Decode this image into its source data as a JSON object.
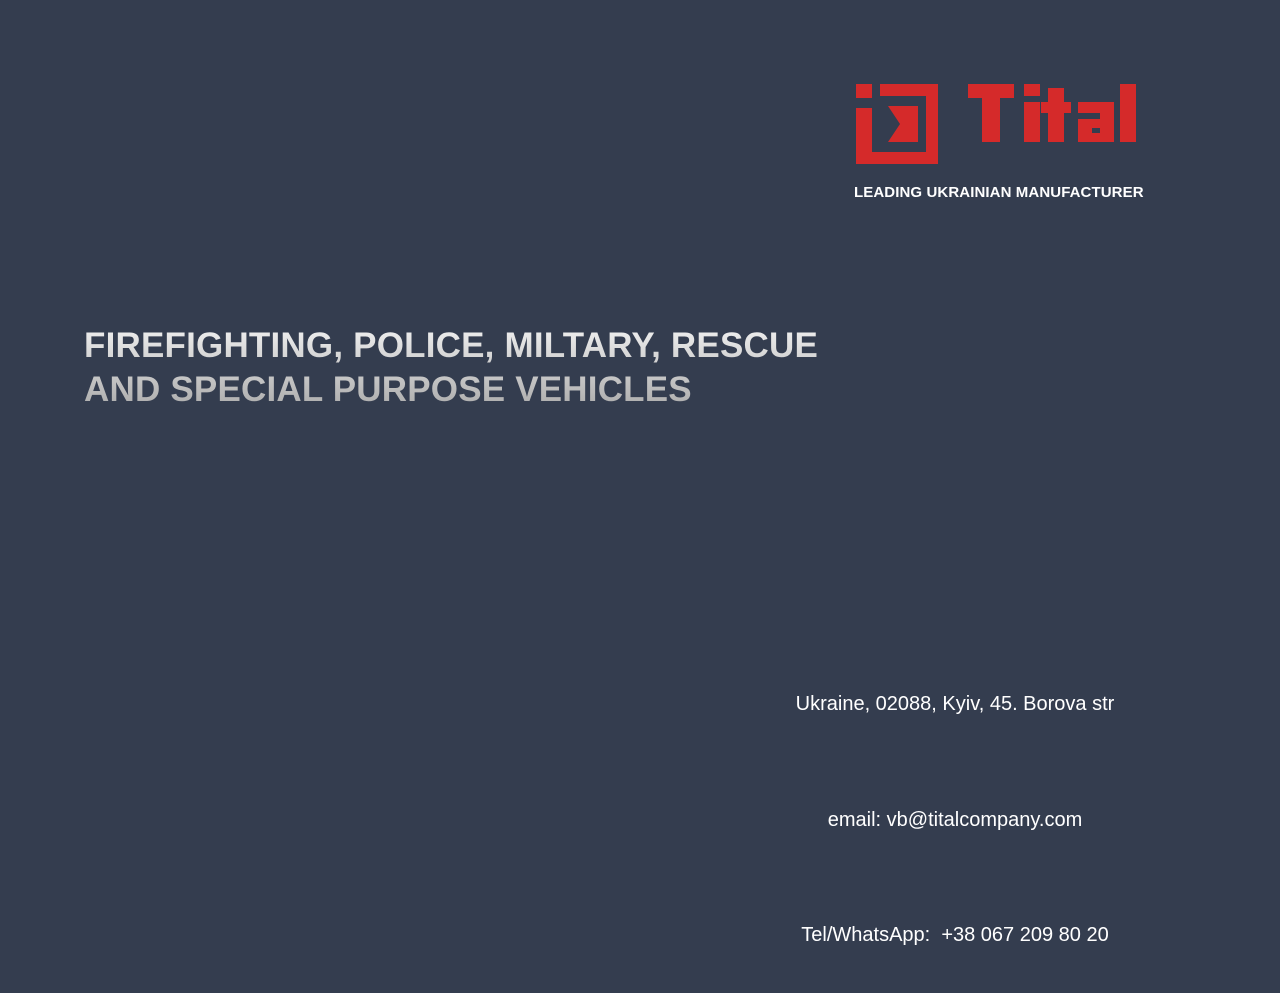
{
  "brand": {
    "logo_text": "Tital",
    "logo_color": "#d52a2a",
    "tagline": "LEADING UKRAINIAN MANUFACTURER"
  },
  "headline": {
    "line1": "FIREFIGHTING, POLICE, MILTARY, RESCUE",
    "line2": "AND SPECIAL PURPOSE VEHICLES"
  },
  "contact": {
    "address": "Ukraine, 02088, Kyiv, 45. Borova str",
    "email": "email: vb@titalcompany.com",
    "phone": "Tel/WhatsApp:  +38 067 209 80 20"
  },
  "colors": {
    "background": "#343d4f",
    "text": "#ffffff"
  }
}
